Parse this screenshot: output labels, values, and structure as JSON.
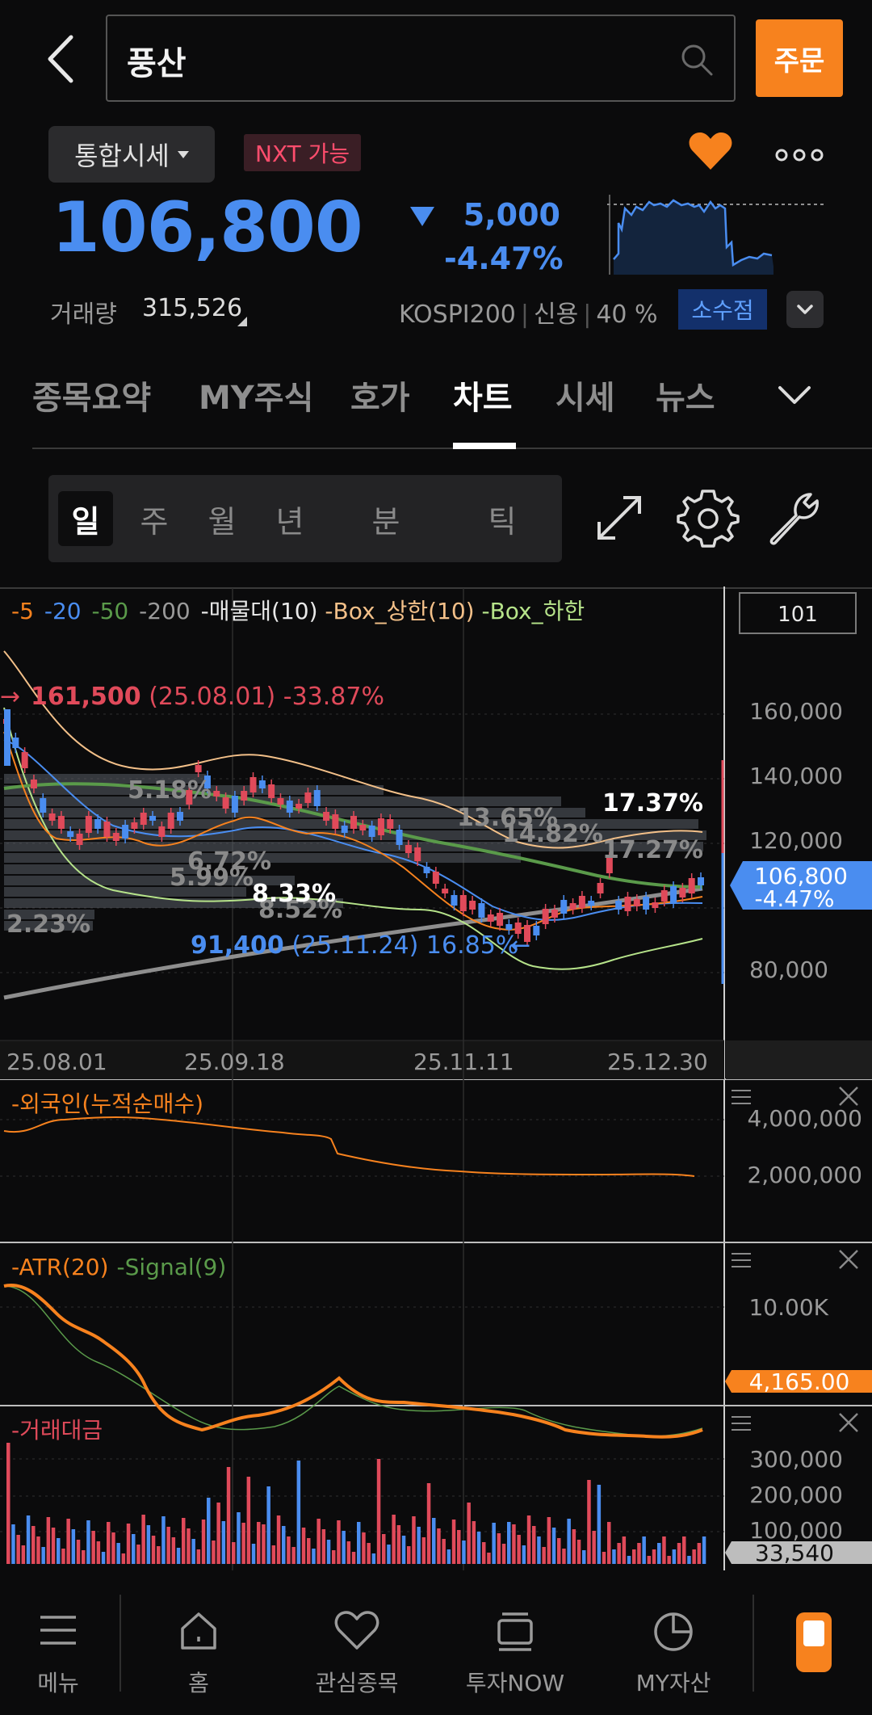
{
  "header": {
    "search_value": "풍산",
    "order_label": "주문"
  },
  "quote": {
    "market_select": "통합시세",
    "nxt_badge": "NXT 가능",
    "price": "106,800",
    "change": "5,000",
    "change_pct": "-4.47%",
    "volume_label": "거래량",
    "volume_value": "315,526",
    "index": "KOSPI200",
    "credit_label": "신용",
    "credit_value": "40 %",
    "decimal_button": "소수점"
  },
  "tabs": [
    {
      "label": "종목요약",
      "active": false
    },
    {
      "label": "MY주식",
      "active": false
    },
    {
      "label": "호가",
      "active": false
    },
    {
      "label": "차트",
      "active": true
    },
    {
      "label": "시세",
      "active": false
    },
    {
      "label": "뉴스",
      "active": false
    }
  ],
  "periods": [
    "일",
    "주",
    "월",
    "년",
    "분",
    "틱"
  ],
  "active_period": "일",
  "chart": {
    "legend": [
      "5",
      "20",
      "50",
      "200",
      "매물대(10)",
      "Box_상한(10)",
      "Box_하한"
    ],
    "count_box": "101",
    "y_ticks": [
      "160,000",
      "140,000",
      "120,000",
      "80,000"
    ],
    "x_ticks": [
      "25.08.01",
      "25.09.18",
      "25.11.11",
      "25.12.30"
    ],
    "high_annotation": {
      "value": "161,500",
      "date": "(25.08.01)",
      "pct": "-33.87%"
    },
    "low_annotation": {
      "value": "91,400",
      "date": "(25.11.24)",
      "pct": "16.85%"
    },
    "vp_labels": [
      "5.18%",
      "13.65%",
      "14.82%",
      "17.27%",
      "6.72%",
      "5.99%",
      "8.52%",
      "2.23%"
    ],
    "vp_highlight_1": "17.37%",
    "vp_highlight_2": "8.33%",
    "last_price_tag": "106,800",
    "last_pct_tag": "-4.47%",
    "foreign_title": "외국인(누적순매수)",
    "foreign_ticks": [
      "4,000,000",
      "2,000,000"
    ],
    "atr_legend": [
      "ATR(20)",
      "Signal(9)"
    ],
    "atr_tick": "10.00K",
    "atr_value_tag": "4,165.00",
    "amount_title": "거래대금",
    "amount_ticks": [
      "300,000",
      "200,000",
      "100,000"
    ],
    "amount_value_tag": "33,540"
  },
  "chart_data": {
    "type": "candlestick",
    "title": "",
    "x_start": "25.08.01",
    "x_end": "25.12.30",
    "ylim": [
      70000,
      170000
    ],
    "high": 161500,
    "low": 91400,
    "last": 106800,
    "ma5_color": "#f7821e",
    "ma20_color": "#4a8df0",
    "ma50_color": "#5a9a4a",
    "ma200_color": "#9a9a9a",
    "up_color": "#e04a5a",
    "down_color": "#4a8df0"
  },
  "nav": [
    {
      "label": "메뉴",
      "icon": "menu-icon"
    },
    {
      "label": "홈",
      "icon": "home-icon"
    },
    {
      "label": "관심종목",
      "icon": "heart-icon"
    },
    {
      "label": "투자NOW",
      "icon": "stack-icon"
    },
    {
      "label": "MY자산",
      "icon": "pie-icon"
    }
  ]
}
